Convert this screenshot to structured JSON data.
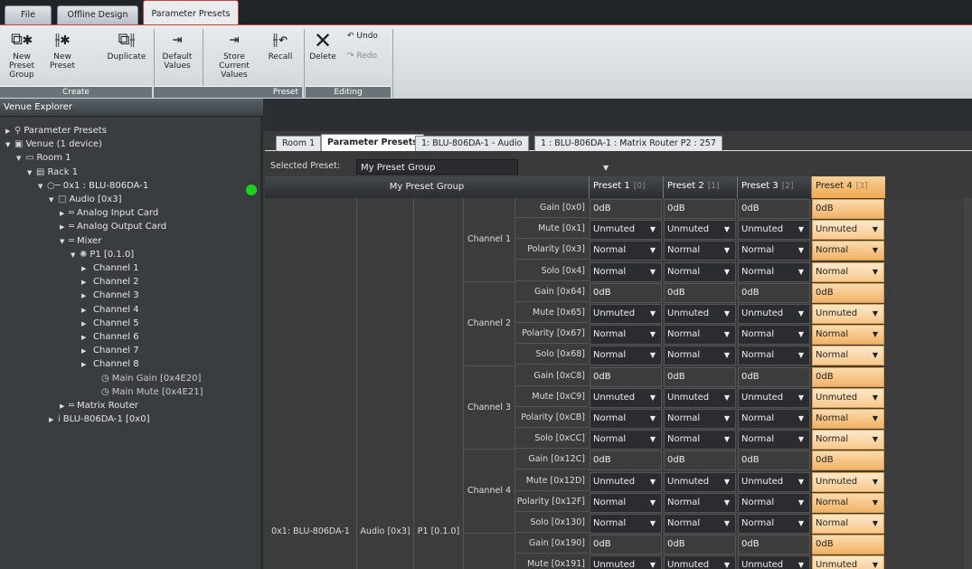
{
  "menu_tabs": [
    "File",
    "Offline Design",
    "Parameter Presets"
  ],
  "ribbon": {
    "buttons": [
      {
        "label1": "New Preset",
        "label2": "Group",
        "icon": "preset-group-icon"
      },
      {
        "label1": "New",
        "label2": "Preset",
        "icon": "new-preset-icon"
      },
      {
        "label1": "Duplicate",
        "label2": "",
        "icon": "duplicate-icon"
      },
      {
        "label1": "Default",
        "label2": "Values",
        "icon": "default-values-icon"
      },
      {
        "label1": "Store Current",
        "label2": "Values",
        "icon": "store-values-icon"
      },
      {
        "label1": "Recall",
        "label2": "",
        "icon": "recall-icon"
      },
      {
        "label1": "Delete",
        "label2": "",
        "icon": "delete-icon"
      }
    ],
    "undo": "Undo",
    "redo": "Redo",
    "groups": [
      "Create",
      "Preset",
      "Editing"
    ]
  },
  "explorer": {
    "title": "Venue Explorer",
    "items": [
      {
        "label": "Parameter Presets",
        "indent": 0,
        "arrow": "▶",
        "icon": "⚲"
      },
      {
        "label": "Venue (1 device)",
        "indent": 0,
        "arrow": "▼",
        "icon": "▣"
      },
      {
        "label": "Room 1",
        "indent": 1,
        "arrow": "▼",
        "icon": "▭"
      },
      {
        "label": "Rack 1",
        "indent": 2,
        "arrow": "▼",
        "icon": "▤"
      },
      {
        "label": "0x1 : BLU-806DA-1",
        "indent": 3,
        "arrow": "▼",
        "icon": "○─"
      },
      {
        "label": "Audio [0x3]",
        "indent": 4,
        "arrow": "▼",
        "icon": "□"
      },
      {
        "label": "Analog Input Card",
        "indent": 5,
        "arrow": "▶",
        "icon": "═"
      },
      {
        "label": "Analog Output Card",
        "indent": 5,
        "arrow": "▶",
        "icon": "═"
      },
      {
        "label": "Mixer",
        "indent": 5,
        "arrow": "▼",
        "icon": "═"
      },
      {
        "label": "P1 [0.1.0]",
        "indent": 6,
        "arrow": "▼",
        "icon": "✺"
      },
      {
        "label": "Channel 1",
        "indent": 7,
        "arrow": "▶",
        "icon": ""
      },
      {
        "label": "Channel 2",
        "indent": 7,
        "arrow": "▶",
        "icon": ""
      },
      {
        "label": "Channel 3",
        "indent": 7,
        "arrow": "▶",
        "icon": ""
      },
      {
        "label": "Channel 4",
        "indent": 7,
        "arrow": "▶",
        "icon": ""
      },
      {
        "label": "Channel 5",
        "indent": 7,
        "arrow": "▶",
        "icon": ""
      },
      {
        "label": "Channel 6",
        "indent": 7,
        "arrow": "▶",
        "icon": ""
      },
      {
        "label": "Channel 7",
        "indent": 7,
        "arrow": "▶",
        "icon": ""
      },
      {
        "label": "Channel 8",
        "indent": 7,
        "arrow": "▶",
        "icon": ""
      },
      {
        "label": "Main Gain [0x4E20]",
        "indent": 8,
        "arrow": "",
        "icon": "◷"
      },
      {
        "label": "Main Mute [0x4E21]",
        "indent": 8,
        "arrow": "",
        "icon": "◷"
      },
      {
        "label": "Matrix Router",
        "indent": 5,
        "arrow": "▶",
        "icon": "═"
      },
      {
        "label": "BLU-806DA-1 [0x0]",
        "indent": 4,
        "arrow": "▶",
        "icon": "i"
      }
    ]
  },
  "doc_tabs": [
    "Room 1",
    "Parameter Presets",
    "1: BLU-806DA-1 - Audio",
    "1 : BLU-806DA-1 : Matrix Router P2 : 257"
  ],
  "selected_preset": {
    "label": "Selected Preset:",
    "value": "My Preset Group"
  },
  "table": {
    "group_header": "My Preset Group",
    "presets": [
      {
        "name": "Preset 1",
        "idx": "[0]"
      },
      {
        "name": "Preset 2",
        "idx": "[1]"
      },
      {
        "name": "Preset 3",
        "idx": "[2]"
      },
      {
        "name": "Preset 4",
        "idx": "[3]"
      }
    ],
    "device": "0x1: BLU-806DA-1",
    "object": "Audio [0x3]",
    "processor": "P1 [0.1.0]",
    "channels": [
      {
        "name": "Channel 1",
        "rows": [
          {
            "label": "Gain [0x0]",
            "value": "0dB",
            "dd": false
          },
          {
            "label": "Mute [0x1]",
            "value": "Unmuted",
            "dd": true
          },
          {
            "label": "Polarity [0x3]",
            "value": "Normal",
            "dd": true
          },
          {
            "label": "Solo [0x4]",
            "value": "Normal",
            "dd": true
          }
        ]
      },
      {
        "name": "Channel 2",
        "rows": [
          {
            "label": "Gain [0x64]",
            "value": "0dB",
            "dd": false
          },
          {
            "label": "Mute [0x65]",
            "value": "Unmuted",
            "dd": true
          },
          {
            "label": "Polarity [0x67]",
            "value": "Normal",
            "dd": true
          },
          {
            "label": "Solo [0x68]",
            "value": "Normal",
            "dd": true
          }
        ]
      },
      {
        "name": "Channel 3",
        "rows": [
          {
            "label": "Gain [0xC8]",
            "value": "0dB",
            "dd": false
          },
          {
            "label": "Mute [0xC9]",
            "value": "Unmuted",
            "dd": true
          },
          {
            "label": "Polarity [0xCB]",
            "value": "Normal",
            "dd": true
          },
          {
            "label": "Solo [0xCC]",
            "value": "Normal",
            "dd": true
          }
        ]
      },
      {
        "name": "Channel 4",
        "rows": [
          {
            "label": "Gain [0x12C]",
            "value": "0dB",
            "dd": false
          },
          {
            "label": "Mute [0x12D]",
            "value": "Unmuted",
            "dd": true
          },
          {
            "label": "Polarity [0x12F]",
            "value": "Normal",
            "dd": true
          },
          {
            "label": "Solo [0x130]",
            "value": "Normal",
            "dd": true
          }
        ]
      },
      {
        "name": "",
        "rows": [
          {
            "label": "Gain [0x190]",
            "value": "0dB",
            "dd": false
          },
          {
            "label": "Mute [0x191]",
            "value": "Unmuted",
            "dd": true
          }
        ]
      }
    ]
  },
  "colors": {
    "accent": "#c1443e",
    "preset4": "#f2b266",
    "device_online": "#19d419"
  }
}
